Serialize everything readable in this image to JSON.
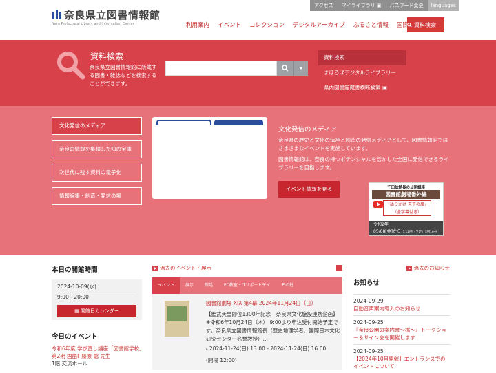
{
  "header": {
    "logo_text": "奈良県立図書情報館",
    "logo_sub": "Nara Prefectural Library and Information Center",
    "util": [
      "アクセス",
      "マイライブラリ",
      "パスワード変更"
    ],
    "lang": "languages",
    "nav": [
      "利用案内",
      "イベント",
      "コレクション",
      "デジタルアーカイブ",
      "ふるさと情報",
      "国際交流"
    ],
    "search_btn": "資料検索"
  },
  "search": {
    "title": "資料検索",
    "desc": "奈良県立図書情報館に所蔵する図書・雑誌などを検索することができます。",
    "placeholder": "",
    "links": [
      "資料検索",
      "まほろばデジタルライブラリー",
      "県内図書館蔵書横断検索"
    ]
  },
  "media": {
    "menu": [
      "文化発信のメディア",
      "奈良の情報を集積した知の宝庫",
      "次世代に残す資料の電子化",
      "情報編集・創造・発信の場"
    ],
    "title": "文化発信のメディア",
    "p1": "奈良県の歴史と文化の伝承と創造の発信メディアとして、図書情報館ではさまざまなイベントを実施しています。",
    "p2": "図書情報館は、奈良の持つポテンシャルを活かした全国に発信できるライブラリーを目指します。",
    "event_button": "イベント情報を見る",
    "banner": {
      "line1": "千田稔館長の公開講座",
      "line2": "図書館劇場番外編",
      "line3": "「語りかけ 天平の風」",
      "line4": "（全字幕付き）",
      "line5": "令和2年",
      "line6": "05/08[金]から",
      "line7": "全12回（予定）1回10分"
    }
  },
  "today": {
    "title": "本日の開館時間",
    "date": "2024-10-09(水)",
    "hours": "9:00 - 20:00",
    "calendar": "開館日カレンダー",
    "events_title": "今日のイベント",
    "event1": "令和6年度 学び直し講座「図書館学校」第2期 国語Ⅱ 藤原 聡 先生",
    "event1_place": "1階 交流ホール"
  },
  "events": {
    "past_link": "過去のイベント・展示",
    "tabs": [
      "イベント",
      "展示",
      "館話",
      "PC教室・ITサポートデイ",
      "その他"
    ],
    "item_title": "図書館劇場 XIX 第4幕 2024年11月24日（日）",
    "item_desc": "【聖武天皇即位1300年記念　奈良県文化施設連携企画】 ※令和6年10月24日（木） 9:00より申込受付開始予定です。奈良県立図書情報館長（歴史地理学者、国際日本文化研究センター名誉教授）…",
    "item_time": "2024-11-24(日) 13:00 - 2024-11-24(日) 16:00",
    "item_open": "(開場 12:00)"
  },
  "news": {
    "past_link": "過去のお知らせ",
    "title": "お知らせ",
    "items": [
      {
        "date": "2024-09-29",
        "text": "自動音声案内導入のお知らせ"
      },
      {
        "date": "2024-09-25",
        "text": "『奈良公園の案内書～栃～』トークショー＆サイン会を開催します"
      },
      {
        "date": "2024-09-25",
        "text": "【2024年10月開催】エントランスでのイベントについて"
      }
    ]
  }
}
